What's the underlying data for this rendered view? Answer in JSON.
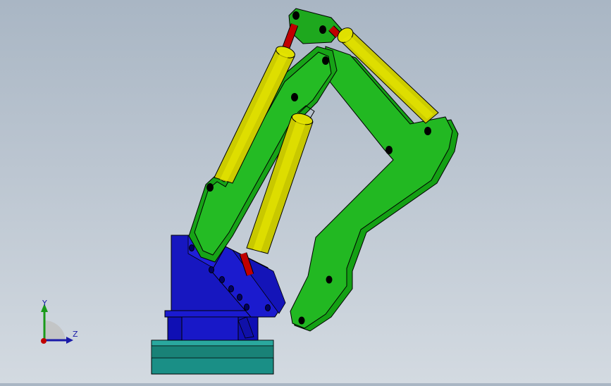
{
  "viewport": {
    "model": "excavator-arm-assembly"
  },
  "triad": {
    "y_label": "Y",
    "z_label": "Z",
    "x_icon": "x-axis-arrow-icon",
    "y_icon": "y-axis-arrow-icon",
    "z_icon": "z-axis-arrow-icon"
  },
  "colors": {
    "background_top": "#a9b6c4",
    "background_bottom": "#d3dae1",
    "arm_green": "#1fb21f",
    "cylinder_yellow": "#d8d800",
    "rod_red": "#c00000",
    "base_blue": "#1515c8",
    "plate_teal": "#1a8f86"
  }
}
